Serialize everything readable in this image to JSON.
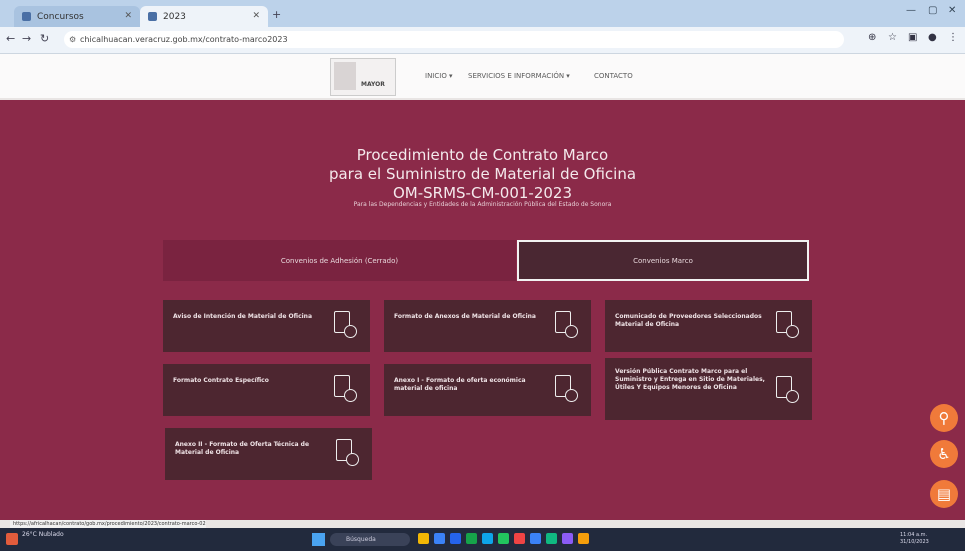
{
  "browser": {
    "tab1_label": "Concursos",
    "tab2_label": "2023",
    "url": "chicalhuacan.veracruz.gob.mx/contrato-marco2023",
    "status_url": "https://africalhacan/contrato/gob.mx/procedimiento/2023/contrato-marco-02..."
  },
  "site": {
    "logo_text": "MAYOR",
    "menu": [
      "INICIO ▾",
      "SERVICIOS E INFORMACIÓN ▾",
      "CONTACTO"
    ]
  },
  "hero": {
    "line1": "Procedimiento de Contrato Marco",
    "line2": "para el Suministro de Material de Oficina",
    "line3": "OM-SRMS-CM-001-2023",
    "subtitle": "Para las Dependencias y Entidades de la Administración Pública del Estado de Sonora"
  },
  "tabs": [
    "Convenios de Adhesión (Cerrado)",
    "Convenios Marco"
  ],
  "cards": [
    "Aviso de Intención de Material de Oficina",
    "Formato de Anexos de Material de Oficina",
    "Comunicado de Proveedores Seleccionados Material de Oficina",
    "Formato Contrato Específico",
    "Anexo I - Formato de oferta económica material de oficina",
    "Versión Pública Contrato Marco para el Suministro y Entrega en Sitio de Materiales, Útiles Y Equipos Menores de Oficina",
    "Anexo II - Formato de Oferta Técnica de Material de Oficina"
  ],
  "taskbar": {
    "left_text": "26°C Nublado",
    "search_placeholder": "Búsqueda",
    "time": "11:04 a.m.",
    "date": "31/10/2023"
  },
  "colors": {
    "hero_bg": "#8b2a49",
    "card_bg": "#4d2630",
    "fab": "#f07a3a"
  }
}
